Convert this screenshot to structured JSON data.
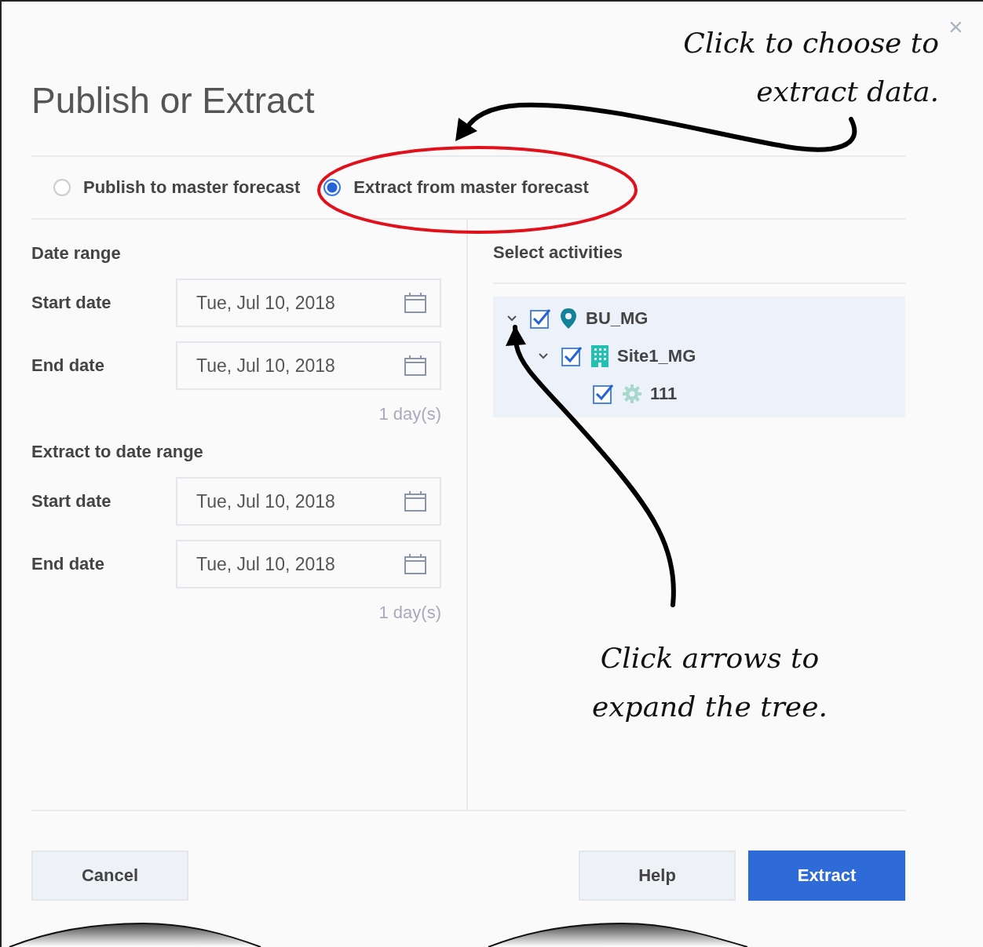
{
  "dialog": {
    "title": "Publish or Extract",
    "close": "×"
  },
  "modes": [
    {
      "label": "Publish to master forecast",
      "selected": false
    },
    {
      "label": "Extract from master forecast",
      "selected": true
    }
  ],
  "ranges": [
    {
      "heading": "Date range",
      "fields": [
        {
          "label": "Start date",
          "value": "Tue, Jul 10, 2018"
        },
        {
          "label": "End date",
          "value": "Tue, Jul 10, 2018"
        }
      ],
      "duration": "1 day(s)"
    },
    {
      "heading": "Extract to date range",
      "fields": [
        {
          "label": "Start date",
          "value": "Tue, Jul 10, 2018"
        },
        {
          "label": "End date",
          "value": "Tue, Jul 10, 2018"
        }
      ],
      "duration": "1 day(s)"
    }
  ],
  "activities": {
    "heading": "Select activities",
    "tree": [
      {
        "label": "BU_MG",
        "kind": "location",
        "checked": true,
        "expanded": true,
        "children": [
          {
            "label": "Site1_MG",
            "kind": "building",
            "checked": true,
            "expanded": true,
            "children": [
              {
                "label": "111",
                "kind": "gear",
                "checked": true
              }
            ]
          }
        ]
      }
    ]
  },
  "buttons": [
    {
      "label": "Cancel",
      "kind": "secondary"
    },
    {
      "label": "Help",
      "kind": "secondary"
    },
    {
      "label": "Extract",
      "kind": "primary"
    }
  ],
  "annotations": [
    {
      "lines": [
        "Click to choose to",
        "extract data."
      ]
    },
    {
      "lines": [
        "Click arrows to",
        "expand the tree."
      ]
    }
  ]
}
